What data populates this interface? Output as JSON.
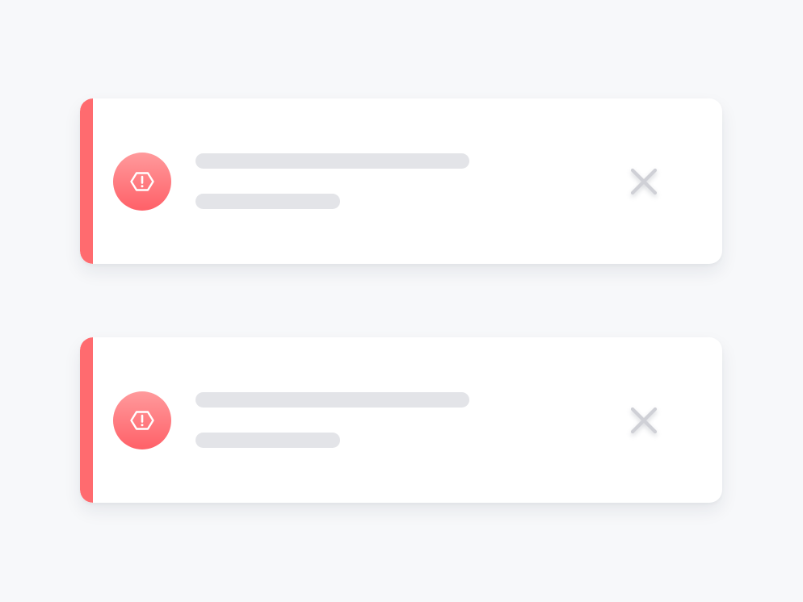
{
  "theme": {
    "page_background": "#f7f8fa",
    "card_background": "#ffffff",
    "accent_color": "#ff6b6f",
    "icon_gradient_start": "#ff9a9c",
    "icon_gradient_end": "#ff6068",
    "placeholder_line_color": "#e3e4e8",
    "close_icon_color": "#cfd0d6"
  },
  "alerts": [
    {
      "type": "error",
      "status_icon": "warning-hexagon-icon",
      "title_placeholder": true,
      "body_placeholder": true,
      "dismiss_icon": "close-icon"
    },
    {
      "type": "error",
      "status_icon": "warning-hexagon-icon",
      "title_placeholder": true,
      "body_placeholder": true,
      "dismiss_icon": "close-icon"
    }
  ]
}
